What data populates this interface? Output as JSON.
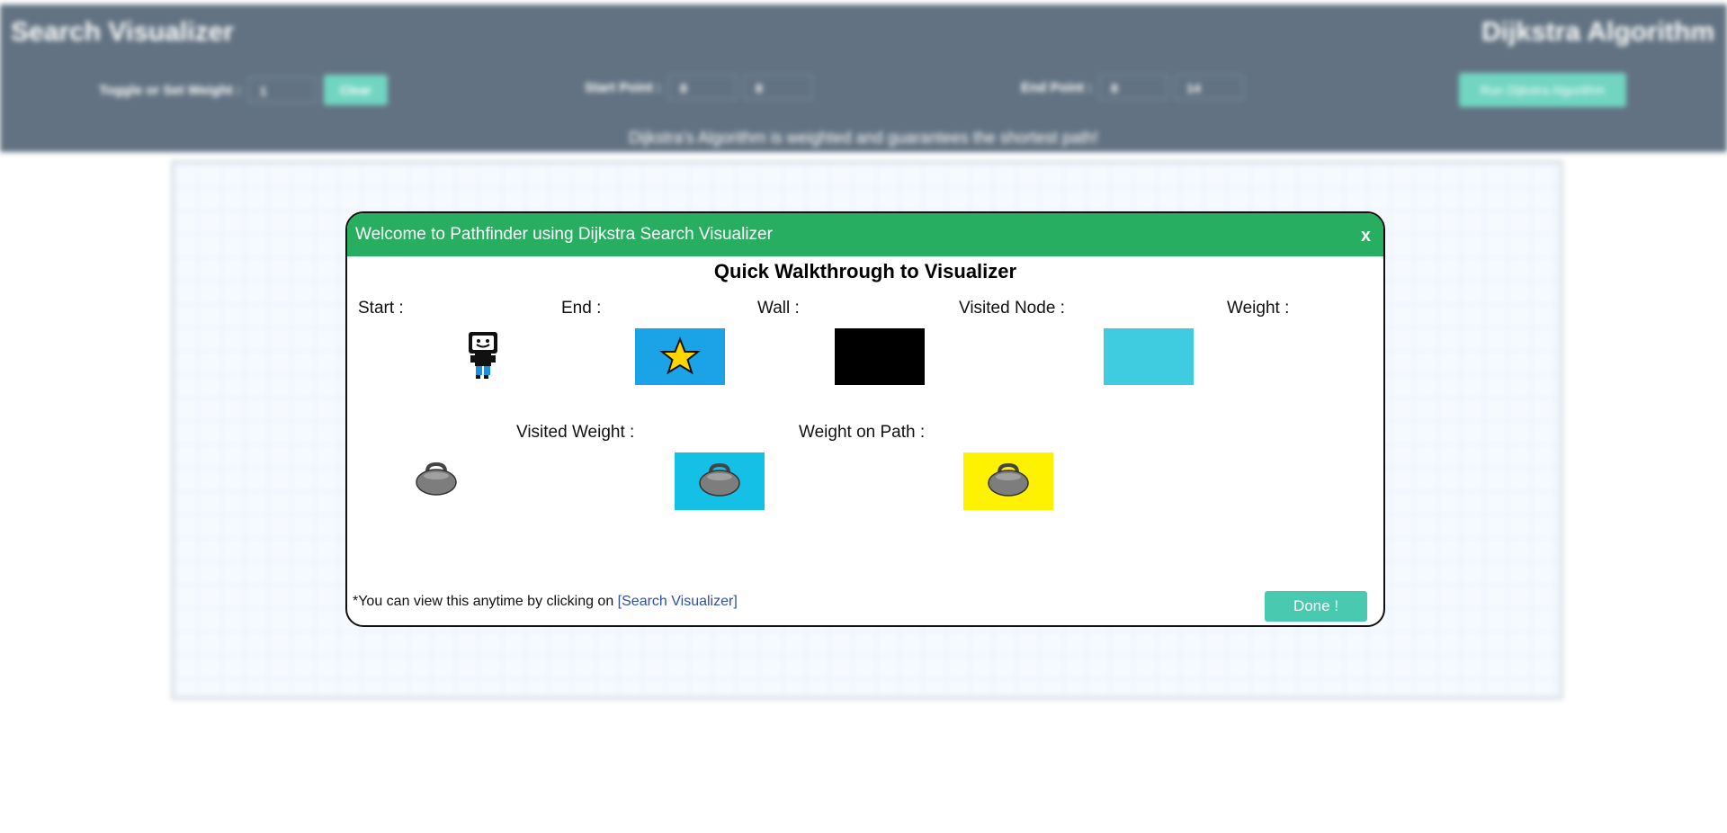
{
  "navbar": {
    "title": "Search Visualizer",
    "algorithm": "Dijkstra Algorithm",
    "weight_label": "Toggle or Set Weight :",
    "weight_value": "1",
    "weight_button": "Clear",
    "start_label": "Start Point :",
    "start_row": "8",
    "start_col": "8",
    "end_label": "End Point :",
    "end_row": "8",
    "end_col": "14",
    "run_button": "Run Dijkstra Algorithm",
    "description": "Dijkstra's Algorithm is weighted and guarantees the shortest path!"
  },
  "modal": {
    "title": "Welcome to Pathfinder using Dijkstra Search Visualizer",
    "close": "x",
    "heading": "Quick Walkthrough to Visualizer",
    "legend": {
      "start": "Start :",
      "end": "End :",
      "wall": "Wall :",
      "visited_node": "Visited Node :",
      "weight": "Weight :",
      "visited_weight": "Visited Weight :",
      "weight_on_path": "Weight on Path :"
    },
    "footnote_text": "*You can view this anytime by clicking on ",
    "footnote_link": "[Search Visualizer]",
    "done_button": "Done !"
  },
  "colors": {
    "header": "#27ae60",
    "navbar": "#34495e",
    "end_swatch": "#1aa3e6",
    "wall_swatch": "#000000",
    "visited_swatch": "#40cce0",
    "visited_weight_swatch": "#15c0e6",
    "weight_path_swatch": "#fff200",
    "button": "#48c9b0"
  },
  "icons": {
    "start": "robot-icon",
    "end": "star-icon",
    "weight": "kettlebell-icon"
  }
}
